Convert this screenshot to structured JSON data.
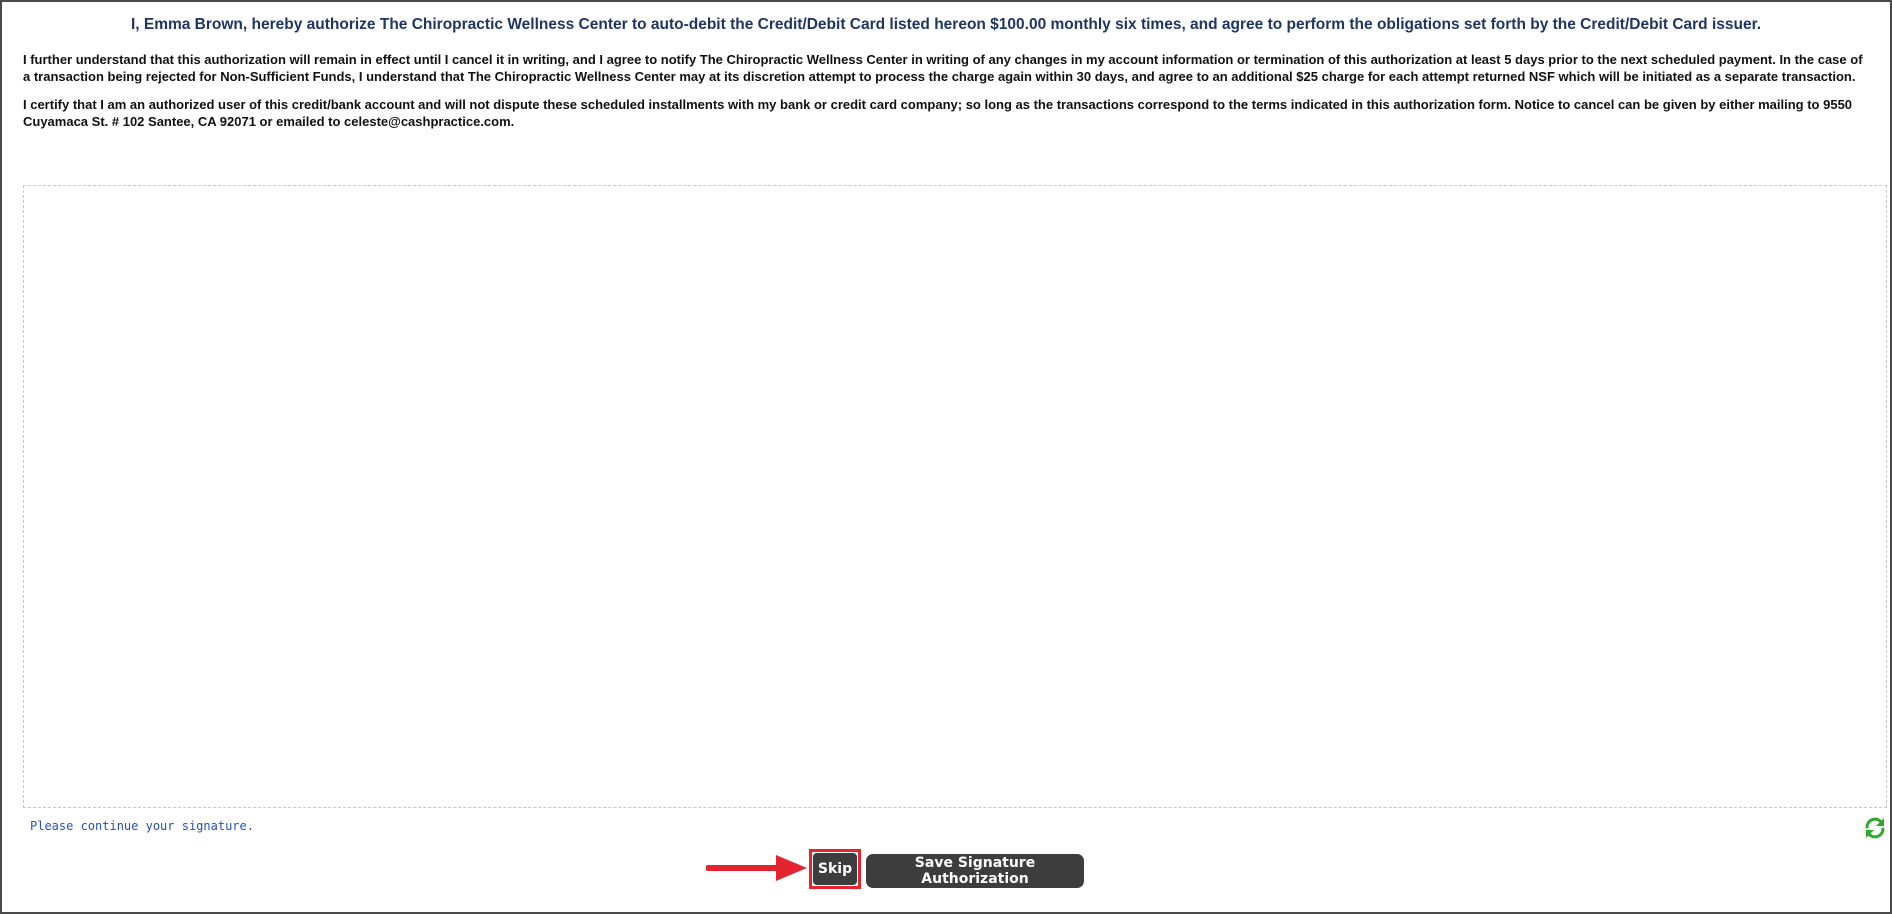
{
  "authorization": {
    "heading": "I, Emma Brown, hereby authorize The Chiropractic Wellness Center to auto-debit the Credit/Debit Card listed hereon $100.00 monthly six times, and agree to perform the obligations set forth by the Credit/Debit Card issuer.",
    "paragraph_1": "I further understand that this authorization will remain in effect until I cancel it in writing, and I agree to notify The Chiropractic Wellness Center in writing of any changes in my account information or termination of this authorization at least 5 days prior to the next scheduled payment. In the case of a transaction being rejected for Non-Sufficient Funds, I understand that The Chiropractic Wellness Center may at its discretion attempt to process the charge again within 30 days, and agree to an additional $25 charge for each attempt returned NSF which will be initiated as a separate transaction.",
    "paragraph_2": "I certify that I am an authorized user of this credit/bank account and will not dispute these scheduled installments with my bank or credit card company; so long as the transactions correspond to the terms indicated in this authorization form.  Notice to cancel can be given by either mailing to 9550 Cuyamaca St. # 102 Santee, CA 92071 or emailed to celeste@cashpractice.com."
  },
  "signature": {
    "status_text": "Please continue your signature.",
    "clear_icon": "refresh-icon"
  },
  "actions": {
    "skip_label": "Skip",
    "save_label": "Save Signature Authorization"
  },
  "annotation": {
    "arrow_color": "#e4252f",
    "highlight_color": "#e4252f"
  },
  "colors": {
    "heading": "#1f3566",
    "status_text": "#2150c8",
    "button_bg": "#3d3d3d",
    "refresh_icon": "#2fa82f"
  }
}
